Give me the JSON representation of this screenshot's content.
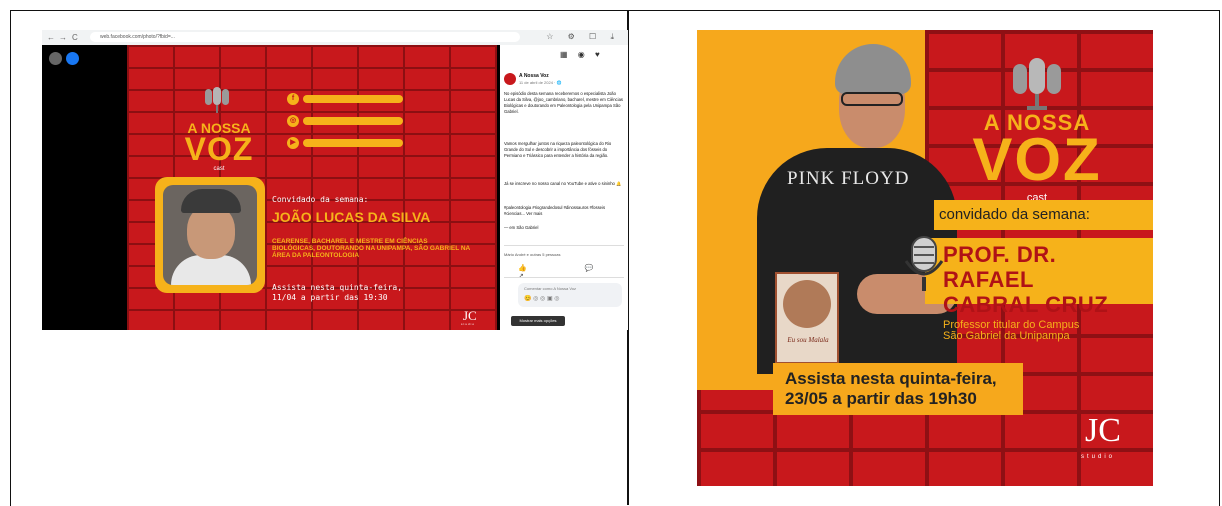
{
  "browser": {
    "url": "web.facebook.com/photo/?fbid=...",
    "nav_back": "←",
    "nav_forward": "→",
    "nav_reload": "C",
    "toolbar_icons": "☆ ⚙ ☐ ⤓"
  },
  "left_poster": {
    "brand_line1": "A NOSSA",
    "brand_line2": "VOZ",
    "brand_line3": "cast",
    "guest_label": "Convidado da semana:",
    "guest_name": "JOÃO LUCAS DA SILVA",
    "guest_desc": "CEARENSE, BACHAREL E MESTRE EM CIÊNCIAS BIOLÓGICAS, DOUTORANDO NA UNIPAMPA, SÃO GABRIEL NA ÁREA DA PALEONTOLOGIA",
    "date_line1": "Assista nesta quinta-feira,",
    "date_line2": "11/04 a partir das 19:30",
    "studio_mark": "JC",
    "studio_word": "studio"
  },
  "facebook_post": {
    "page_name": "A Nossa Voz",
    "timestamp": "11 de abril de 2024 · 🌐",
    "para1": "No episódio desta semana receberemos o especialista João Lucas da Silva, @joo_cambriano, bacharel, mestre em Ciências Biológicas e doutorando em Paleontologia pela Unipampa São Gabriel.",
    "para2": "Vamos mergulhar juntos na riqueza paleontológica do Rio Grande do Sul e descobrir a importância dos fósseis do Permiano e Triássico para entender a história da região.",
    "para3": "Já se inscreve no nosso canal no YouTube e ative o sininho 🔔",
    "hashtags": "#paleontologia #riograndedosul #dinossauros #fosseis #ciencias... Ver mais",
    "location": "— em São Gabriel",
    "reactions": "Mário André e outras 5 pessoas",
    "actions": "👍 💬 ↗",
    "comment_placeholder": "Comentar como A Nossa Voz",
    "comment_icons": "😊 ◎ ◎ ▣ ◎",
    "tooltip": "Mostrar mais opções",
    "header_icons": "▦ ◉ ♥"
  },
  "right_poster": {
    "brand_line1": "A NOSSA",
    "brand_line2": "VOZ",
    "brand_line3": "cast",
    "shirt_text": "PINK FLOYD",
    "book_title": "Eu sou Malala",
    "guest_label": "convidado da semana:",
    "guest_name_line1": "PROF. DR. RAFAEL",
    "guest_name_line2": "CABRAL CRUZ",
    "role_line1": "Professor titular do Campus",
    "role_line2": "São Gabriel da Unipampa",
    "date_line1": "Assista nesta quinta-feira,",
    "date_line2": "23/05 a partir das 19h30",
    "studio_mark": "JC",
    "studio_word": "studio"
  },
  "colors": {
    "red": "#c8181c",
    "yellow": "#f6b21a",
    "facebook_blue": "#1877f2"
  }
}
